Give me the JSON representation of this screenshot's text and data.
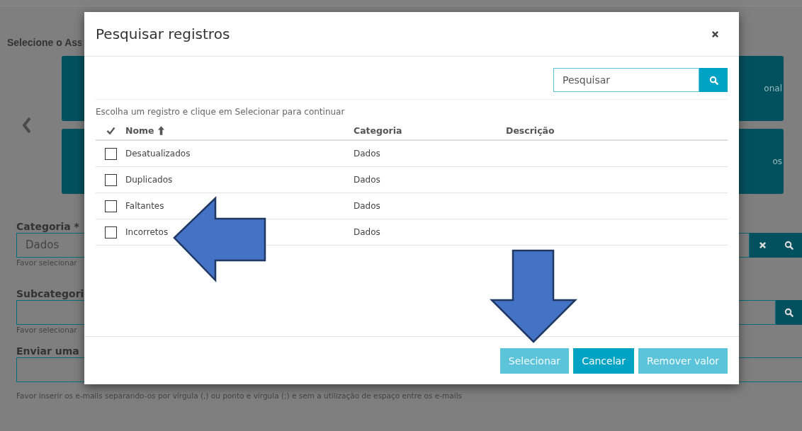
{
  "background": {
    "heading": "Selecione o Ass",
    "tiles_right": [
      "onal",
      "os"
    ],
    "fields": [
      {
        "kind": "lookup_clear",
        "label": "Categoria *",
        "value": "Dados",
        "hint": "Favor selecionar"
      },
      {
        "kind": "lookup",
        "label": "Subcategori",
        "hint": "Favor selecionar"
      },
      {
        "kind": "plain",
        "label": "Enviar uma",
        "hint": "Favor inserir os e-mails separando-os por vírgula (,) ou ponto e vírgula (;) e sem a utilização de espaço entre os e-mails"
      }
    ]
  },
  "modal": {
    "title": "Pesquisar registros",
    "search": {
      "placeholder": "Pesquisar"
    },
    "instruction": "Escolha um registro e clique em Selecionar para continuar",
    "columns": [
      {
        "label": "Nome",
        "sorted": true
      },
      {
        "label": "Categoria",
        "sorted": false
      },
      {
        "label": "Descrição",
        "sorted": false
      }
    ],
    "rows": [
      {
        "name": "Desatualizados",
        "category": "Dados",
        "checked": false
      },
      {
        "name": "Duplicados",
        "category": "Dados",
        "checked": false
      },
      {
        "name": "Faltantes",
        "category": "Dados",
        "checked": false
      },
      {
        "name": "Incorretos",
        "category": "Dados",
        "checked": false
      }
    ],
    "buttons": [
      {
        "label": "Selecionar",
        "disabled": true
      },
      {
        "label": "Cancelar",
        "disabled": false
      },
      {
        "label": "Remover valor",
        "disabled": true
      }
    ]
  }
}
